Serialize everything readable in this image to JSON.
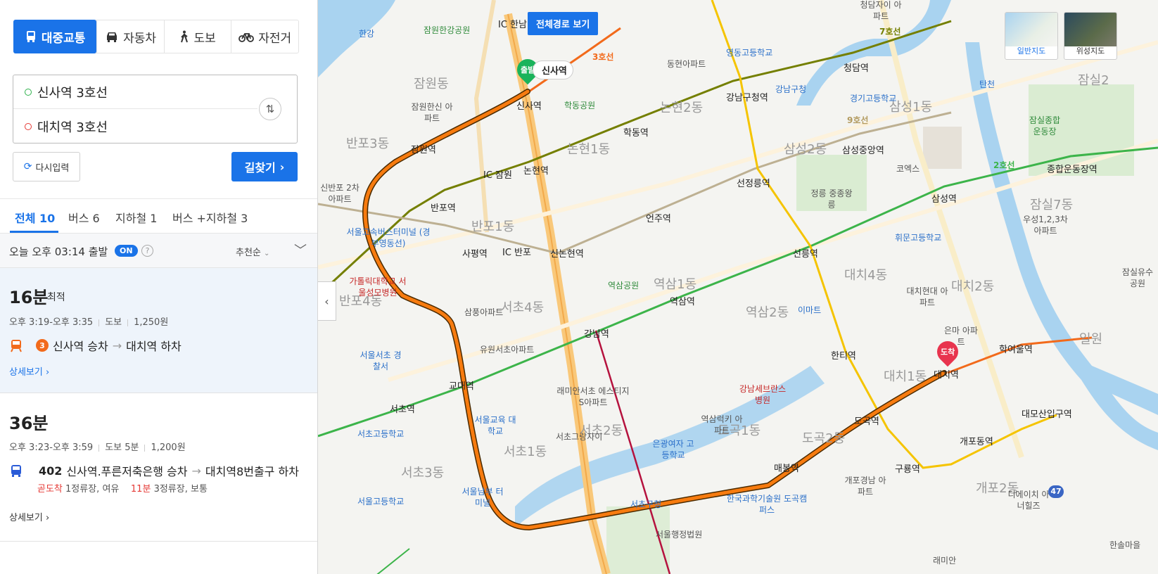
{
  "modes": [
    {
      "label": "대중교통",
      "icon": "bus-icon",
      "active": true
    },
    {
      "label": "자동차",
      "icon": "car-icon",
      "active": false
    },
    {
      "label": "도보",
      "icon": "walk-icon",
      "active": false
    },
    {
      "label": "자전거",
      "icon": "bicycle-icon",
      "active": false
    }
  ],
  "route_inputs": {
    "origin": "신사역 3호선",
    "destination": "대치역 3호선"
  },
  "actions": {
    "reset": "다시입력",
    "search": "길찾기"
  },
  "tabs": [
    {
      "label": "전체 10",
      "active": true
    },
    {
      "label": "버스 6",
      "active": false
    },
    {
      "label": "지하철 1",
      "active": false
    },
    {
      "label": "버스 +지하철 3",
      "active": false
    }
  ],
  "departure": {
    "text": "오늘 오후 03:14 출발",
    "toggle": "ON",
    "help": "?",
    "sort": "추천순"
  },
  "results": [
    {
      "duration": "16분",
      "tag": "최적",
      "time": "오후 3:19-오후 3:35",
      "walk": "도보",
      "fare": "1,250원",
      "line_badge": "3",
      "board": "신사역 승차",
      "alight": "대치역 하차",
      "detail": "상세보기"
    },
    {
      "duration": "36분",
      "time": "오후 3:23-오후 3:59",
      "walk": "도보 5분",
      "fare": "1,200원",
      "bus_no": "402",
      "board": "신사역.푸른저축은행 승차",
      "alight": "대치역8번출구 하차",
      "arrival1_status": "곧도착",
      "arrival1_info": "1정류장, 여유",
      "arrival2_status": "11분",
      "arrival2_info": "3정류장, 보통",
      "detail": "상세보기"
    }
  ],
  "map": {
    "full_route_button": "전체경로 보기",
    "start_pin": "출발",
    "start_station": "신사역",
    "end_pin": "도착",
    "map_types": [
      "일반지도",
      "위성지도"
    ],
    "road_badge": "47",
    "line_labels": {
      "line3": "3호선",
      "line7": "7호선",
      "line2": "2호선",
      "line9": "9호선"
    },
    "ic_labels": [
      "IC 한남",
      "IC 잠원",
      "IC 반포"
    ],
    "stations": [
      "신사역",
      "잠원역",
      "반포역",
      "논현역",
      "학동역",
      "강남구청역",
      "청담역",
      "선정릉역",
      "삼성중앙역",
      "삼성역",
      "종합운동장역",
      "선릉역",
      "언주역",
      "신논현역",
      "사평역",
      "강남역",
      "역삼역",
      "한티역",
      "대치역",
      "학여울역",
      "도곡역",
      "매봉역",
      "교대역",
      "서초역",
      "구룡역",
      "개포동역",
      "대모산입구역"
    ],
    "dongs": [
      "잠원동",
      "논현2동",
      "논현1동",
      "반포3동",
      "삼성1동",
      "삼성2동",
      "반포1동",
      "잠실7동",
      "대치4동",
      "대치2동",
      "역삼1동",
      "역삼2동",
      "반포4동",
      "서초4동",
      "대치1동",
      "서초2동",
      "서초1동",
      "도곡2동",
      "도곡1동",
      "서초3동",
      "개포2동",
      "일원",
      "잠실2"
    ],
    "pois": [
      "한강",
      "잠원한강공원",
      "청담자이 아파트",
      "영동고등학교",
      "동현아파트",
      "강남구청",
      "경기고등학교",
      "학동공원",
      "잠원한신 아파트",
      "탄천",
      "잠실종합 운동장",
      "코엑스",
      "정릉 중종왕릉",
      "신반포 2차아파트",
      "서울고속버스터미널 (경부영동선)",
      "휘문고등학교",
      "가톨릭대학교 서울성모병원",
      "역삼공원",
      "우성1,2,3차 아파트",
      "대치현대 아파트",
      "삼풍아파트",
      "이마트",
      "은마 아파트",
      "유원서초아파트",
      "서울서초 경찰서",
      "강남세브란스 병원",
      "래미안서초 에스티지S아파트",
      "서울교육 대학교",
      "서초그랑자이",
      "역삼럭키 아파트",
      "서초고등학교",
      "은광여자 고등학교",
      "개포경남 아파트",
      "디에이치 아너힐즈",
      "서울고등학교",
      "서울남부 터미널",
      "서초구청",
      "한국과학기술원 도곡캠퍼스",
      "서울행정법원",
      "한솔마을",
      "래미안",
      "잠실유수 공원"
    ]
  },
  "colors": {
    "accent": "#1a73e8",
    "route": "#f77b0f",
    "line3": "#f26a1b",
    "line2": "#3cb44a",
    "line7": "#747f00",
    "line9": "#bdb092",
    "bundang": "#f5c400",
    "shinbundang": "#b5123e",
    "water": "#a9d3f0",
    "park": "#cfe8c4"
  }
}
